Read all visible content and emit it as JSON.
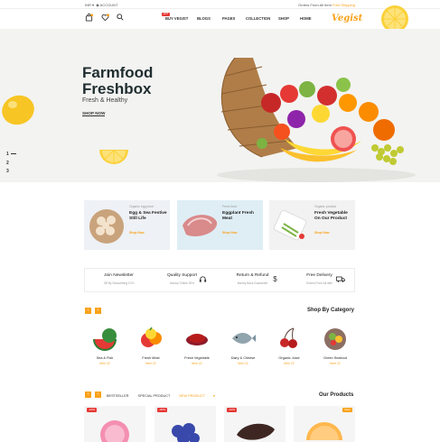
{
  "topbar": {
    "currency": "INR",
    "account": "ACCOUNT",
    "promo_prefix": "Orders From All Item",
    "promo_highlight": "Free Shipping"
  },
  "nav": {
    "hot_badge": "HOT",
    "menu": [
      "BUY VEGIST",
      "BLOGS",
      "PAGES",
      "COLLECTION",
      "SHOP",
      "HOME"
    ],
    "logo": "Vegist",
    "icons": [
      "bag-icon",
      "heart-icon",
      "search-icon"
    ]
  },
  "hero": {
    "title_line1": "Farmfood",
    "title_line2": "Freshbox",
    "subtitle": "Fresh & Healthy",
    "cta": "SHOP NOW",
    "slides": [
      "1",
      "2",
      "3"
    ]
  },
  "banners": [
    {
      "small": "Organic egg plant",
      "title": "Egg & Sea Festive Still Life",
      "cta": "Shop Now"
    },
    {
      "small": "Fresh food",
      "title": "Eggplant Fresh Meat",
      "cta": "Shop Now"
    },
    {
      "small": "Organic product",
      "title": "Fresh Vegetable On Our Product",
      "cta": "Shop Now"
    }
  ],
  "features": [
    {
      "title": "Join Newsletter",
      "sub": "Off By Subscribing 10%"
    },
    {
      "title": "Quality Support",
      "sub": "Money Online 30%"
    },
    {
      "title": "Return & Refund",
      "sub": "Money Back Guarantee"
    },
    {
      "title": "Free Delivery",
      "sub": "Orders From All Item"
    }
  ],
  "category": {
    "heading": "Shop By Category",
    "items": [
      {
        "name": "Sea & Fish",
        "count": "Item 22"
      },
      {
        "name": "Fresh Meat",
        "count": "Item 22"
      },
      {
        "name": "Fresh Vegetable",
        "count": "Item 22"
      },
      {
        "name": "Dairy & Cheese",
        "count": "Item 22"
      },
      {
        "name": "Organic Juice",
        "count": "Item 22"
      },
      {
        "name": "Green Seafood",
        "count": "Item 22"
      }
    ]
  },
  "products": {
    "heading": "Our Products",
    "tabs": [
      "BESTSELLER",
      "SPECIAL PRODUCT",
      "NEW PRODUCT"
    ],
    "tags": [
      "-10%",
      "-20%",
      "-10%",
      "New"
    ]
  },
  "colors": {
    "accent": "#f9a21a",
    "sale": "#e53935",
    "hero_bg": "#f3f3f1"
  }
}
